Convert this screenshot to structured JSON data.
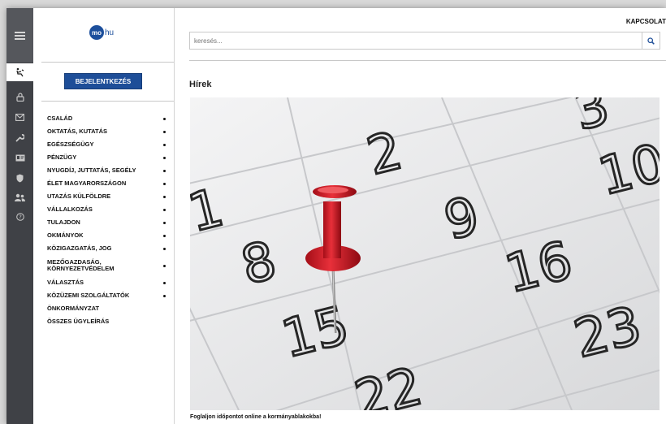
{
  "logo": {
    "circle_text": "mo",
    "suffix": "hu"
  },
  "login_button": "BEJELENTKEZÉS",
  "rail_icons": [
    "menu-icon",
    "accessibility-icon",
    "lock-icon",
    "mail-icon",
    "wrench-icon",
    "id-card-icon",
    "shield-icon",
    "users-icon",
    "help-icon"
  ],
  "menu": [
    {
      "label": "CSALÁD"
    },
    {
      "label": "OKTATÁS, KUTATÁS"
    },
    {
      "label": "EGÉSZSÉGÜGY"
    },
    {
      "label": "PÉNZÜGY"
    },
    {
      "label": "NYUGDÍJ, JUTTATÁS, SEGÉLY"
    },
    {
      "label": "ÉLET MAGYARORSZÁGON"
    },
    {
      "label": "UTAZÁS KÜLFÖLDRE"
    },
    {
      "label": "VÁLLALKOZÁS"
    },
    {
      "label": "TULAJDON"
    },
    {
      "label": "OKMÁNYOK"
    },
    {
      "label": "KÖZIGAZGATÁS, JOG"
    },
    {
      "label": "MEZŐGAZDASÁG, KÖRNYEZETVÉDELEM"
    },
    {
      "label": "VÁLASZTÁS"
    },
    {
      "label": "KÖZÜZEMI SZOLGÁLTATÓK"
    },
    {
      "label": "ÖNKORMÁNYZAT"
    },
    {
      "label": "ÖSSZES ÜGYLEÍRÁS"
    }
  ],
  "header": {
    "contact": "KAPCSOLAT"
  },
  "search": {
    "placeholder": "keresés..."
  },
  "news": {
    "title": "Hírek",
    "caption": "Foglaljon időpontot online a kormányablakokba!",
    "calendar_numbers": [
      "3",
      "2",
      "10",
      "1",
      "9",
      "8",
      "16",
      "15",
      "23",
      "22"
    ]
  }
}
